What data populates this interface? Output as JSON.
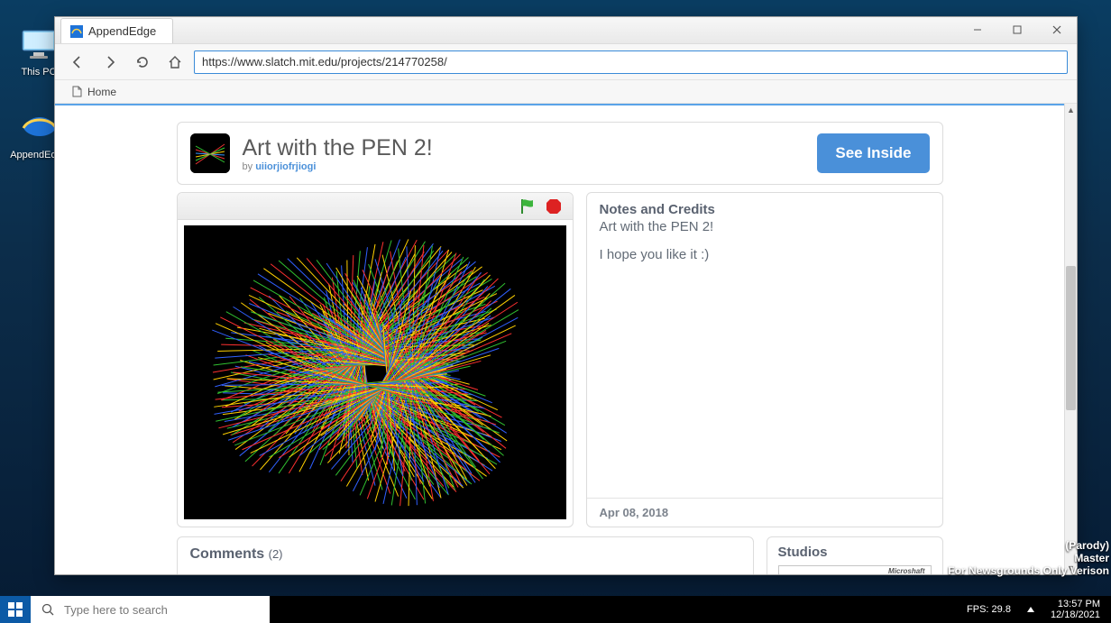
{
  "desktop": {
    "icons": {
      "thispc": "This PC",
      "append": "AppendEdge"
    }
  },
  "window": {
    "tab_title": "AppendEdge",
    "url": "https://www.slatch.mit.edu/projects/214770258/",
    "bookmarks": {
      "home": "Home"
    }
  },
  "project": {
    "title": "Art with the PEN 2!",
    "by_prefix": "by ",
    "author": "uiiorjiofrjiogi",
    "see_inside": "See Inside"
  },
  "notes": {
    "heading": "Notes and Credits",
    "line1": "Art with the PEN 2!",
    "line2": "I hope you like it :)",
    "date": "Apr 08, 2018"
  },
  "comments": {
    "label": "Comments ",
    "count": "(2)"
  },
  "studios": {
    "heading": "Studios",
    "thumb_label": "Microshaft"
  },
  "overlay": {
    "l1": "(Parody)",
    "l2": "Master",
    "l3": "For Newsgrounds Only Verison"
  },
  "taskbar": {
    "search_placeholder": "Type here to search",
    "fps": "FPS: 29.8",
    "time": "13:57 PM",
    "date": "12/18/2021"
  }
}
